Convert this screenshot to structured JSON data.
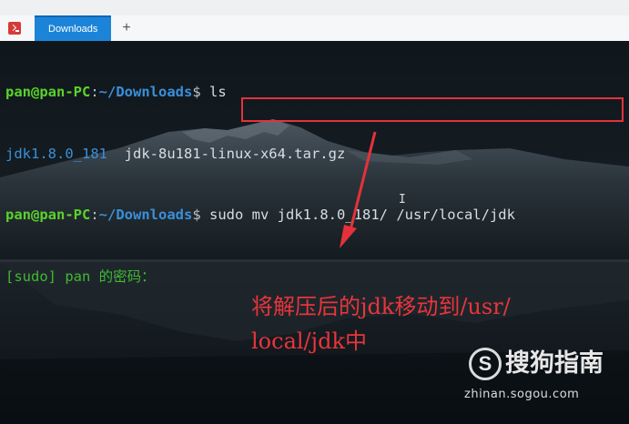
{
  "tabbar": {
    "active_tab": "Downloads",
    "add_tab": "+"
  },
  "terminal": {
    "line1": {
      "user": "pan@pan-PC",
      "sep": ":",
      "path": "~/Downloads",
      "prompt": "$ ",
      "command": "ls"
    },
    "line2": {
      "item1": "jdk1.8.0_181",
      "item2": "jdk-8u181-linux-x64.tar.gz"
    },
    "line3": {
      "user": "pan@pan-PC",
      "sep": ":",
      "path": "~/Downloads",
      "prompt": "$",
      "command": "sudo mv jdk1.8.0_181/ /usr/local/jdk"
    },
    "line4": {
      "sudo_prompt": "[sudo] pan 的密码："
    },
    "text_cursor": "I"
  },
  "annotation": {
    "line1": "将解压后的jdk移动到/usr/",
    "line2": "local/jdk中",
    "color": "#e8353b"
  },
  "watermark": {
    "logo_glyph": "S",
    "brand": "搜狗指南",
    "url": "zhinan.sogou.com"
  },
  "colors": {
    "user_green": "#5ad22a",
    "path_blue": "#3b8fd9",
    "highlight_red": "#e5323a",
    "tab_blue": "#1c84d8"
  }
}
